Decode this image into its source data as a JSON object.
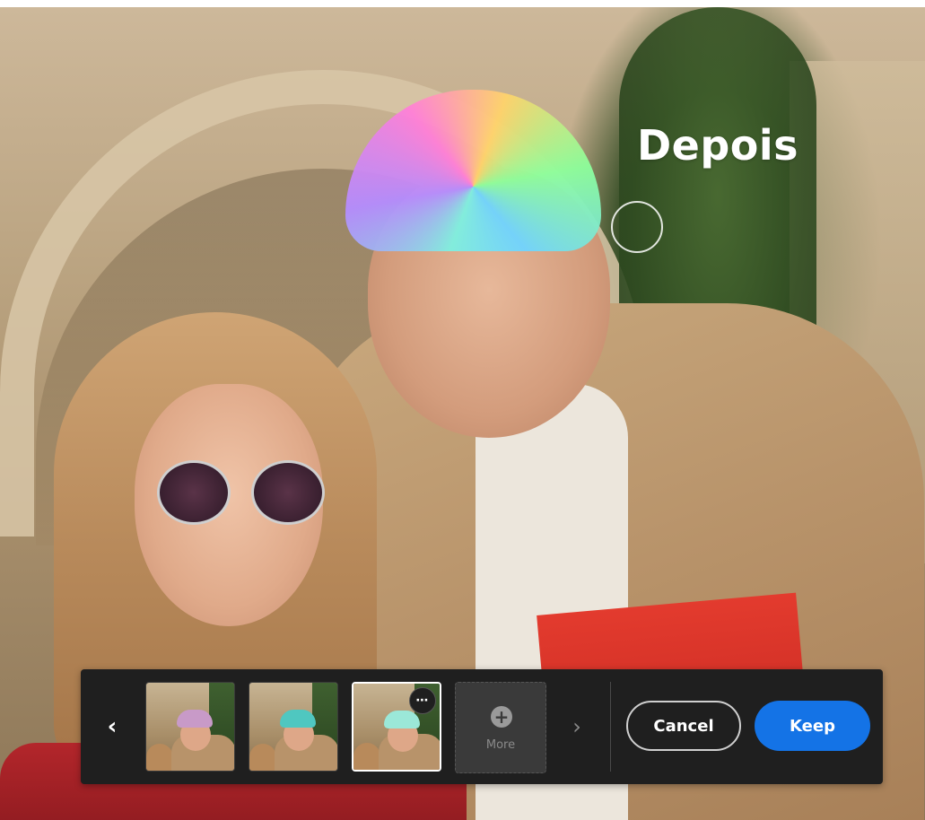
{
  "overlay": {
    "label": "Depois"
  },
  "toolbar": {
    "prev_icon": "‹",
    "next_icon": "›",
    "thumbnails": [
      {
        "hat_color": "#c89ac8"
      },
      {
        "hat_color": "#4fc7c0"
      },
      {
        "hat_color": "#9be8d8",
        "more_icon": "⋯"
      }
    ],
    "more": {
      "icon": "+",
      "label": "More"
    },
    "cancel_label": "Cancel",
    "keep_label": "Keep"
  },
  "colors": {
    "accent": "#1473e6",
    "toolbar_bg": "#1f1f1f"
  }
}
